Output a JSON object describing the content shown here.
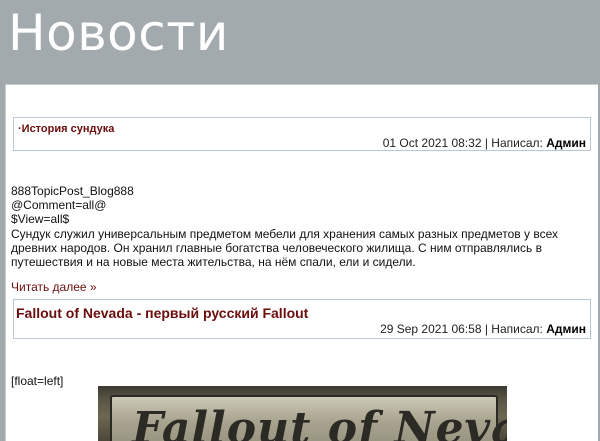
{
  "header": {
    "title": "Новости"
  },
  "posts": [
    {
      "title": "·История сундука",
      "date": "01 Oct 2021 08:32",
      "author_label": "Написал:",
      "author": "Админ",
      "body": [
        "888TopicPost_Blog888",
        "@Comment=all@",
        "$View=all$",
        "Сундук служил универсальным предметом мебели для хранения самых разных предметов у всех древних народов. Он хранил главные богатства человеческого жилища. С ним отправлялись в путешествия и на новые места жительства, на нём спали, ели и сидели."
      ],
      "read_more": "Читать далее »"
    },
    {
      "title": "Fallout of Nevada - первый русский Fallout",
      "date": "29 Sep 2021 06:58",
      "author_label": "Написал:",
      "author": "Админ",
      "float_tag": "[float=left]",
      "image_text": "Fallout of Nevada"
    }
  ],
  "colors": {
    "header_bg": "#a2aaad",
    "title_link": "#6b0d0d",
    "box_border": "#b9c7d8"
  }
}
